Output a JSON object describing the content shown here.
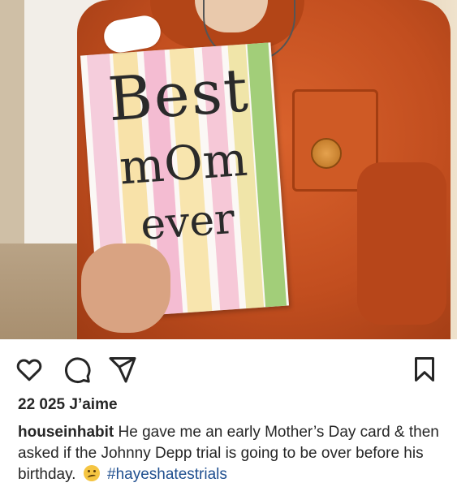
{
  "post": {
    "card_text": {
      "line1": "Best",
      "line2": "mOm",
      "line3": "ever"
    },
    "likes_text": "22 025 J’aime",
    "caption": {
      "username": "houseinhabit",
      "text": " He gave me an early Mother’s Day card & then asked if the Johnny Depp trial is going to be over before his birthday.",
      "emoji_name": "woozy-face",
      "hashtag": "#hayeshatestrials"
    }
  },
  "icons": {
    "like": "heart-icon",
    "comment": "comment-bubble-icon",
    "share": "paper-plane-icon",
    "save": "bookmark-icon"
  },
  "colors": {
    "text": "#262626",
    "hashtag": "#1f4f8f",
    "shirt": "#c24e1f"
  }
}
